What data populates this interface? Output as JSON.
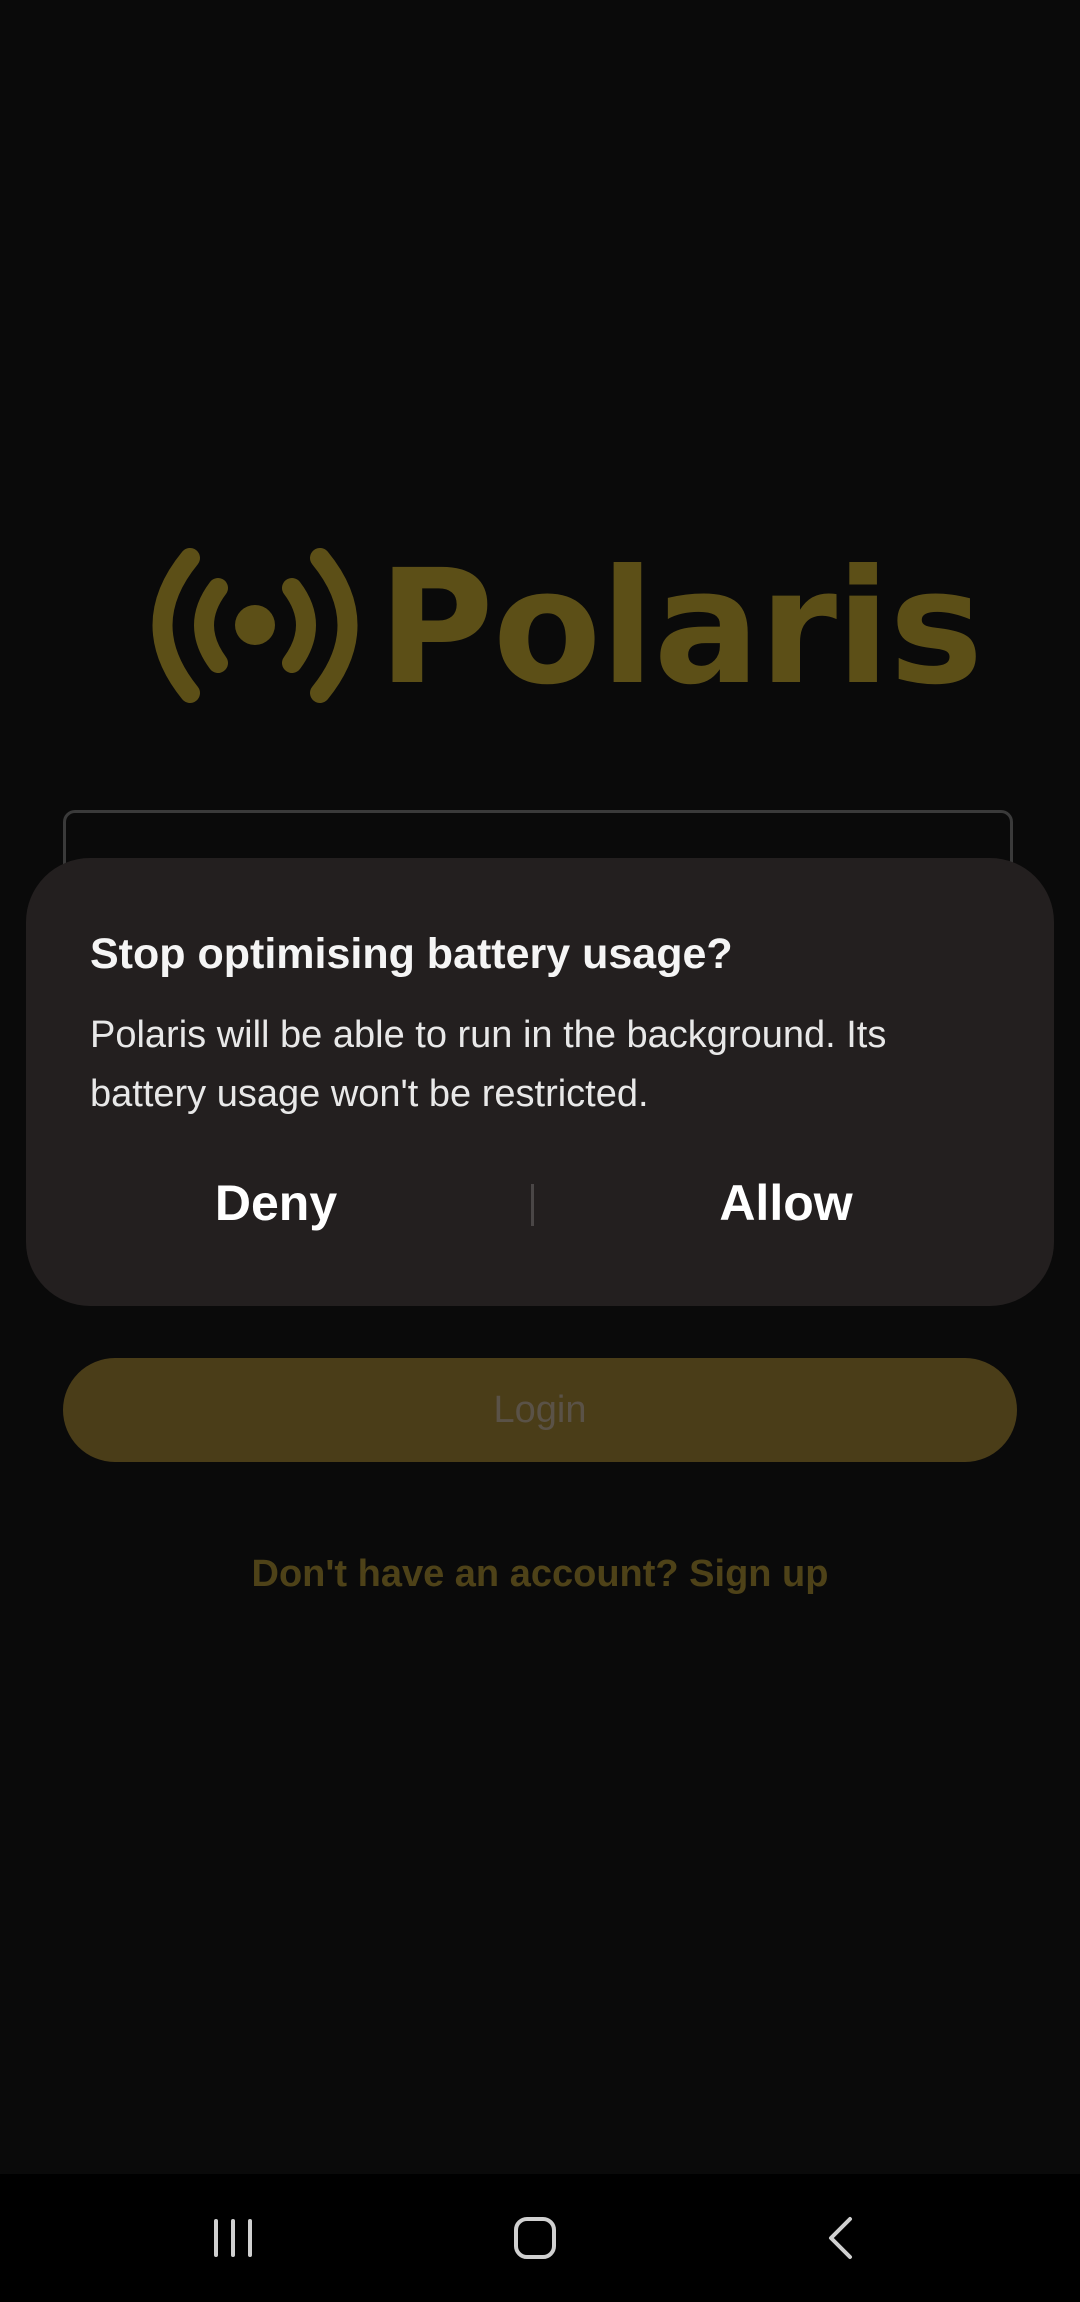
{
  "app": {
    "logo_text": "Polaris"
  },
  "login": {
    "button_label": "Login",
    "signup_text": "Don't have an account? Sign up"
  },
  "dialog": {
    "title": "Stop optimising battery usage?",
    "body": "Polaris will be able to run in the background. Its battery usage won't be restricted.",
    "deny_label": "Deny",
    "allow_label": "Allow"
  },
  "navbar": {
    "recents_icon": "recents-icon",
    "home_icon": "home-icon",
    "back_icon": "back-icon"
  },
  "colors": {
    "brand_gold_dimmed": "#5c4f17",
    "dialog_bg": "#231f1f",
    "screen_bg": "#0a0a0a"
  }
}
